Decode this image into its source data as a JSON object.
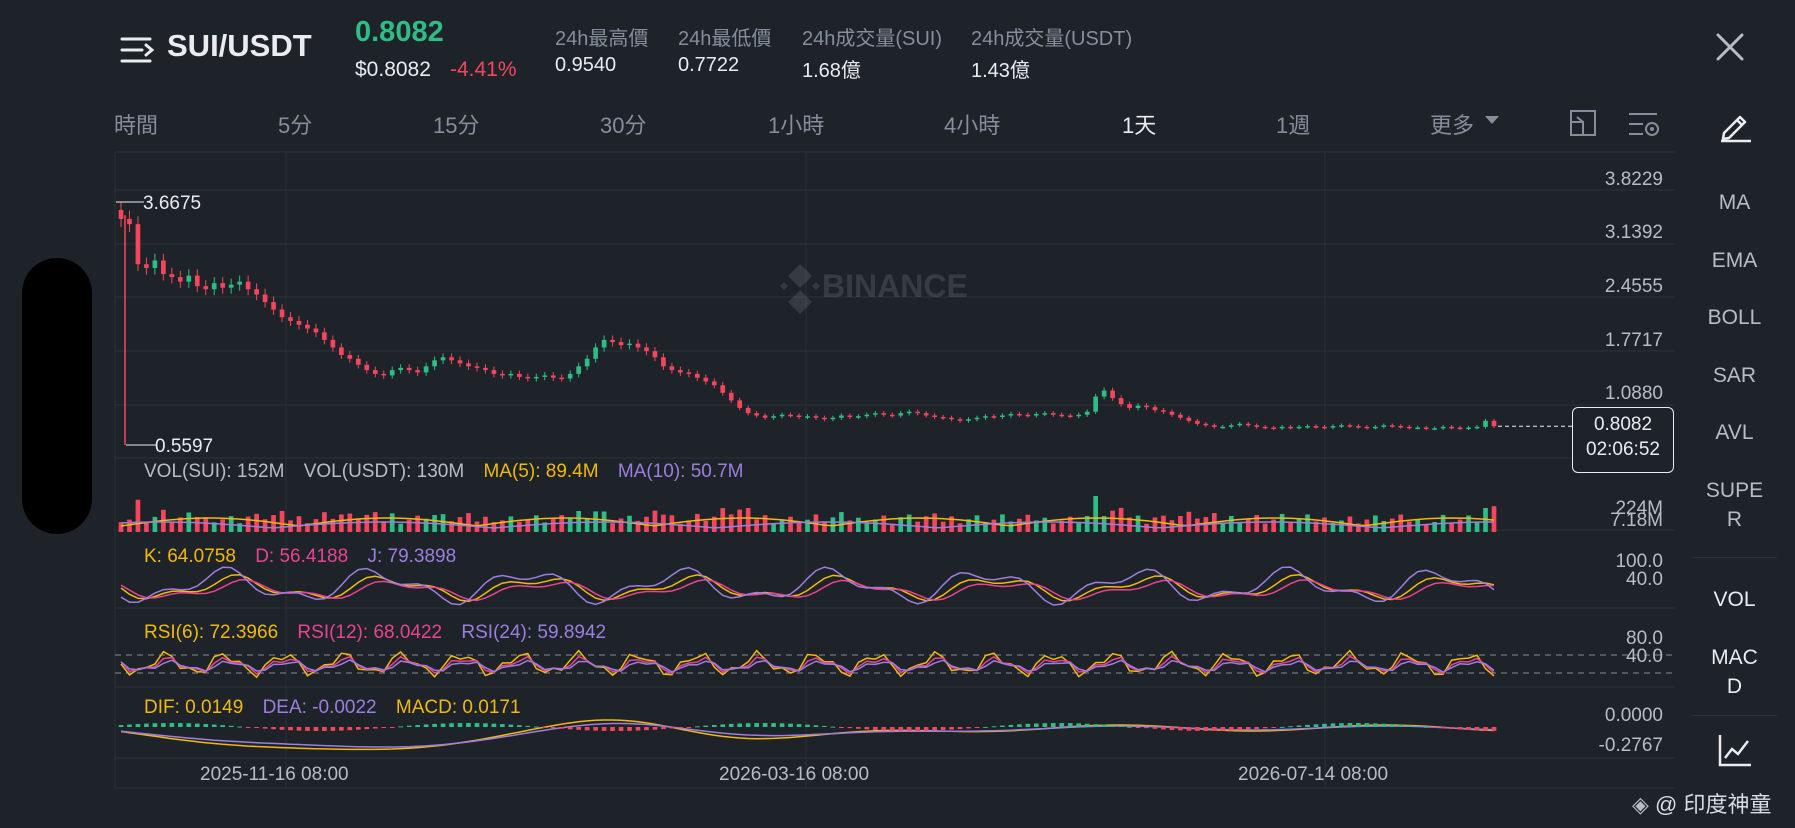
{
  "header": {
    "pair": "SUI/USDT",
    "last_price": "0.8082",
    "fiat_price": "$0.8082",
    "change": "-4.41%",
    "stats": [
      {
        "label": "24h最高價",
        "value": "0.9540"
      },
      {
        "label": "24h最低價",
        "value": "0.7722"
      },
      {
        "label": "24h成交量(SUI)",
        "value": "1.68億"
      },
      {
        "label": "24h成交量(USDT)",
        "value": "1.43億"
      }
    ]
  },
  "tabs": [
    {
      "label": "時間"
    },
    {
      "label": "5分"
    },
    {
      "label": "15分"
    },
    {
      "label": "30分"
    },
    {
      "label": "1小時"
    },
    {
      "label": "4小時"
    },
    {
      "label": "1天"
    },
    {
      "label": "1週"
    },
    {
      "label": "更多"
    }
  ],
  "active_tab": "1天",
  "side_indicators": [
    "MA",
    "EMA",
    "BOLL",
    "SAR",
    "AVL",
    "SUPE\nR",
    "VOL",
    "MAC\nD"
  ],
  "main_chart": {
    "watermark": "BINANCE",
    "y_ticks": [
      "3.8229",
      "3.1392",
      "2.4555",
      "1.7717",
      "1.0880"
    ],
    "high_label": "3.6675",
    "low_label": "0.5597",
    "current_price": "0.8082",
    "countdown": "02:06:52"
  },
  "vol_panel": {
    "legend": [
      {
        "text": "VOL(SUI): 152M",
        "color": "#b7bdc6"
      },
      {
        "text": "VOL(USDT): 130M",
        "color": "#b7bdc6"
      },
      {
        "text": "MA(5): 89.4M",
        "color": "#f0b90b"
      },
      {
        "text": "MA(10): 50.7M",
        "color": "#9c7ee0"
      }
    ],
    "y_ticks": [
      "224M",
      "7.18M"
    ]
  },
  "kdj_panel": {
    "legend": [
      {
        "text": "K: 64.0758",
        "color": "#f0b90b"
      },
      {
        "text": "D: 56.4188",
        "color": "#e84393"
      },
      {
        "text": "J: 79.3898",
        "color": "#9c7ee0"
      }
    ],
    "y_ticks": [
      "100.0",
      "40.0"
    ]
  },
  "rsi_panel": {
    "legend": [
      {
        "text": "RSI(6): 72.3966",
        "color": "#f0b90b"
      },
      {
        "text": "RSI(12): 68.0422",
        "color": "#e84393"
      },
      {
        "text": "RSI(24): 59.8942",
        "color": "#9c7ee0"
      }
    ],
    "y_ticks": [
      "80.0",
      "40.0"
    ]
  },
  "macd_panel": {
    "legend": [
      {
        "text": "DIF: 0.0149",
        "color": "#f0b90b"
      },
      {
        "text": "DEA: -0.0022",
        "color": "#9c7ee0"
      },
      {
        "text": "MACD: 0.0171",
        "color": "#f0b90b"
      }
    ],
    "y_ticks": [
      "0.0000",
      "-0.2767"
    ]
  },
  "x_labels": [
    "2025-11-16 08:00",
    "2026-03-16 08:00",
    "2026-07-14 08:00"
  ],
  "footer": {
    "watermark": "@ 印度神童"
  },
  "colors": {
    "up": "#2ebd85",
    "down": "#f6465d",
    "bg": "#1e2329",
    "grid": "#2b3139"
  },
  "icons": [
    "menu-icon",
    "close-icon",
    "pencil-icon",
    "chevron-down-icon",
    "layout-icon",
    "settings-icon",
    "line-chart-icon",
    "binance-logo-icon"
  ],
  "chart_data": {
    "type": "candlestick",
    "price_range": [
      0.5597,
      3.6675
    ],
    "close_series": [
      3.55,
      3.48,
      2.95,
      2.9,
      3.0,
      2.82,
      2.78,
      2.72,
      2.8,
      2.66,
      2.62,
      2.7,
      2.64,
      2.68,
      2.72,
      2.62,
      2.55,
      2.45,
      2.35,
      2.25,
      2.2,
      2.15,
      2.1,
      2.05,
      1.95,
      1.85,
      1.75,
      1.7,
      1.62,
      1.55,
      1.5,
      1.48,
      1.55,
      1.58,
      1.55,
      1.52,
      1.6,
      1.68,
      1.72,
      1.68,
      1.64,
      1.6,
      1.58,
      1.55,
      1.5,
      1.48,
      1.5,
      1.46,
      1.44,
      1.46,
      1.48,
      1.45,
      1.44,
      1.5,
      1.6,
      1.7,
      1.85,
      1.95,
      1.92,
      1.88,
      1.9,
      1.85,
      1.8,
      1.72,
      1.6,
      1.55,
      1.52,
      1.5,
      1.45,
      1.4,
      1.35,
      1.25,
      1.15,
      1.05,
      0.98,
      0.95,
      0.92,
      0.94,
      0.96,
      0.95,
      0.93,
      0.94,
      0.92,
      0.9,
      0.92,
      0.95,
      0.93,
      0.94,
      0.96,
      0.98,
      0.96,
      0.95,
      0.98,
      1.0,
      0.98,
      0.95,
      0.93,
      0.92,
      0.9,
      0.88,
      0.9,
      0.92,
      0.94,
      0.93,
      0.95,
      0.97,
      0.96,
      0.95,
      0.97,
      0.98,
      0.96,
      0.95,
      0.94,
      0.96,
      1.0,
      1.2,
      1.28,
      1.18,
      1.1,
      1.05,
      1.08,
      1.06,
      1.02,
      1.0,
      0.96,
      0.92,
      0.88,
      0.84,
      0.82,
      0.8,
      0.8,
      0.82,
      0.84,
      0.82,
      0.8,
      0.79,
      0.78,
      0.8,
      0.79,
      0.8,
      0.81,
      0.8,
      0.79,
      0.81,
      0.82,
      0.81,
      0.8,
      0.79,
      0.8,
      0.82,
      0.81,
      0.8,
      0.79,
      0.79,
      0.78,
      0.78,
      0.8,
      0.79,
      0.78,
      0.79,
      0.8,
      0.88,
      0.8082
    ]
  }
}
